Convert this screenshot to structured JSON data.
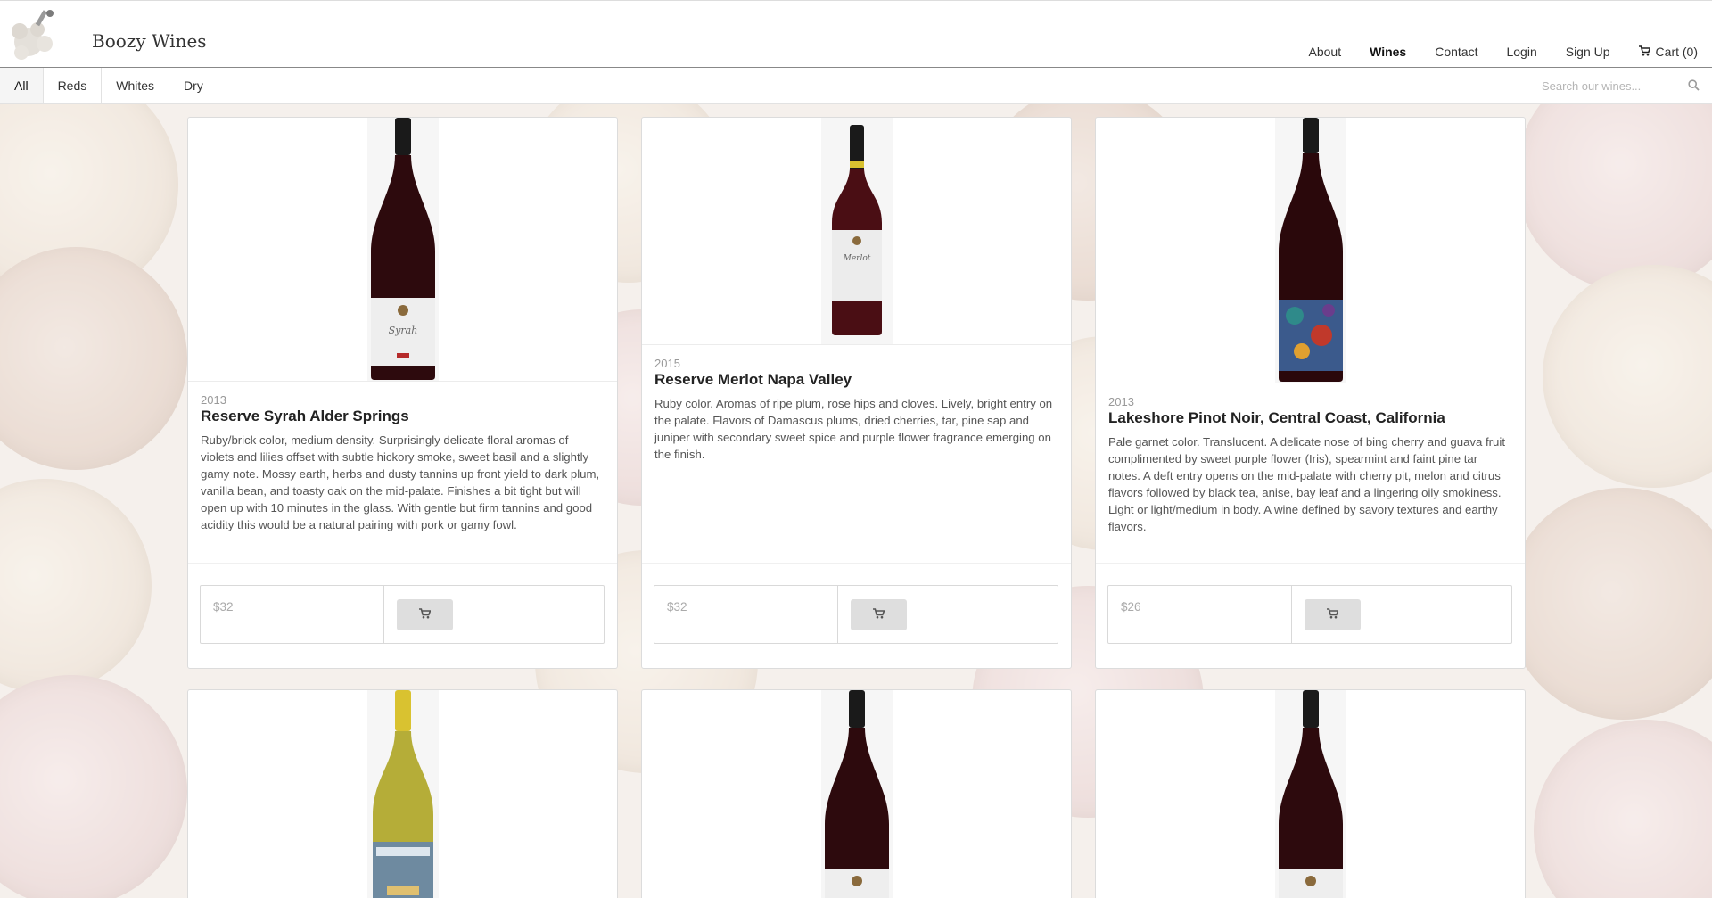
{
  "brand": {
    "name": "Boozy Wines",
    "logo": "grape-mascot-logo"
  },
  "nav": {
    "items": [
      {
        "label": "About",
        "active": false
      },
      {
        "label": "Wines",
        "active": true
      },
      {
        "label": "Contact",
        "active": false
      },
      {
        "label": "Login",
        "active": false
      },
      {
        "label": "Sign Up",
        "active": false
      }
    ],
    "cart_label": "Cart (0)",
    "cart_icon": "shopping-cart-icon"
  },
  "filters": {
    "tabs": [
      {
        "label": "All",
        "active": true
      },
      {
        "label": "Reds",
        "active": false
      },
      {
        "label": "Whites",
        "active": false
      },
      {
        "label": "Dry",
        "active": false
      }
    ],
    "search_placeholder": "Search our wines...",
    "search_icon": "magnifier-icon"
  },
  "wines": [
    {
      "vintage": "2013",
      "name": "Reserve Syrah Alder Springs",
      "description": "Ruby/brick color, medium density. Surprisingly delicate floral aromas of violets and lilies offset with subtle hickory smoke, sweet basil and a slightly gamy note. Mossy earth, herbs and dusty tannins up front yield to dark plum, vanilla bean, and toasty oak on the mid-palate. Finishes a bit tight but will open up with 10 minutes in the glass. With gentle but firm tannins and good acidity this would be a natural pairing with pork or gamy fowl.",
      "price": "$32",
      "label_text": "Syrah"
    },
    {
      "vintage": "2015",
      "name": "Reserve Merlot Napa Valley",
      "description": "Ruby color. Aromas of ripe plum, rose hips and cloves. Lively, bright entry on the palate. Flavors of Damascus plums, dried cherries, tar, pine sap and juniper with secondary sweet spice and purple flower fragrance emerging on the finish.",
      "price": "$32",
      "label_text": "Merlot"
    },
    {
      "vintage": "2013",
      "name": "Lakeshore Pinot Noir, Central Coast, California",
      "description": "Pale garnet color. Translucent. A delicate nose of bing cherry and guava fruit complimented by sweet purple flower (Iris), spearmint and faint pine tar notes. A deft entry opens on the mid-palate with cherry pit, melon and citrus flavors followed by black tea, anise, bay leaf and a lingering oily smokiness. Light or light/medium in body. A wine defined by savory textures and earthy flavors.",
      "price": "$26",
      "label_text": ""
    }
  ],
  "colors": {
    "red_wine": "#3a0a0e",
    "white_wine": "#c9c24a",
    "capsule_dark": "#1a1a1a",
    "capsule_gold": "#d9c230",
    "button_grey": "#dedede"
  }
}
